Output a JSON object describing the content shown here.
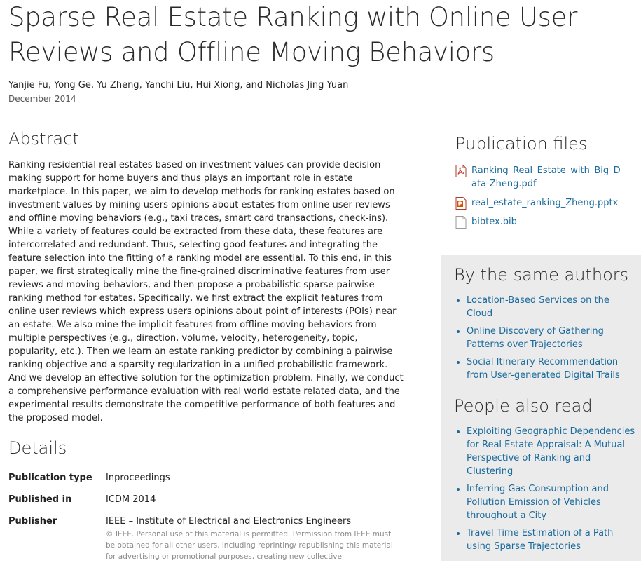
{
  "title": "Sparse Real Estate Ranking with Online User Reviews and Offline Moving Behaviors",
  "authors": "Yanjie Fu, Yong Ge, Yu Zheng, Yanchi Liu, Hui Xiong, and Nicholas Jing Yuan",
  "date": "December 2014",
  "abstract": {
    "heading": "Abstract",
    "text": "Ranking residential real estates based on investment values can provide decision making support for home buyers and thus plays an important role in estate marketplace. In this paper, we aim to develop methods for ranking estates based on investment values by mining users opinions about estates from online user reviews and offline moving behaviors (e.g., taxi traces, smart card transactions, check-ins). While a variety of features could be extracted from these data, these features are intercorrelated and redundant. Thus, selecting good features and integrating the feature selection into the fitting of a ranking model are essential. To this end, in this paper, we first strategically mine the fine-grained discriminative features from user reviews and moving behaviors, and then propose a probabilistic sparse pairwise ranking method for estates. Specifically, we first extract the explicit features from online user reviews which express users opinions about point of interests (POIs) near an estate. We also mine the implicit features from offline moving behaviors from multiple perspectives (e.g., direction, volume, velocity, heterogeneity, topic, popularity, etc.). Then we learn an estate ranking predictor by combining a pairwise ranking objective and a sparsity regularization in a unified probabilistic framework. And we develop an effective solution for the optimization problem. Finally, we conduct a comprehensive performance evaluation with real world estate related data, and the experimental results demonstrate the competitive performance of both features and the proposed model."
  },
  "details": {
    "heading": "Details",
    "rows": [
      {
        "label": "Publication type",
        "value": "Inproceedings"
      },
      {
        "label": "Published in",
        "value": "ICDM 2014"
      },
      {
        "label": "Publisher",
        "value": "IEEE – Institute of Electrical and Electronics Engineers"
      }
    ],
    "copyright": "© IEEE. Personal use of this material is permitted. Permission from IEEE must be obtained for all other users, including reprinting/ republishing this material for advertising or promotional purposes, creating new collective"
  },
  "publication_files": {
    "heading": "Publication files",
    "files": [
      {
        "name": "Ranking_Real_Estate_with_Big_Data-Zheng.pdf",
        "icon": "pdf-file-icon",
        "color": "#c0392b"
      },
      {
        "name": "real_estate_ranking_Zheng.pptx",
        "icon": "pptx-file-icon",
        "color": "#c0392b"
      },
      {
        "name": "bibtex.bib",
        "icon": "generic-file-icon",
        "color": "#999999"
      }
    ]
  },
  "same_authors": {
    "heading": "By the same authors",
    "items": [
      "Location-Based Services on the Cloud",
      "Online Discovery of Gathering Patterns over Trajectories",
      "Social Itinerary Recommendation from User-generated Digital Trails"
    ]
  },
  "also_read": {
    "heading": "People also read",
    "items": [
      "Exploiting Geographic Dependencies for Real Estate Appraisal: A Mutual Perspective of Ranking and Clustering",
      "Inferring Gas Consumption and Pollution Emission of Vehicles throughout a City",
      "Travel Time Estimation of a Path using Sparse Trajectories"
    ]
  },
  "colors": {
    "link": "#1a6a9c",
    "sidebar_bg": "#ebebeb"
  }
}
